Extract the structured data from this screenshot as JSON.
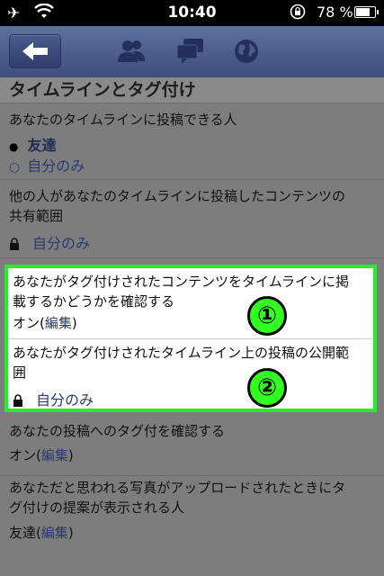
{
  "status_bar": {
    "time": "10:40",
    "battery": "78 %"
  },
  "section": {
    "title": "タイムラインとタグ付け"
  },
  "items": [
    {
      "question": "あなたのタイムラインに投稿できる人",
      "option_selected": "友達",
      "option_other": "自分のみ"
    },
    {
      "question_line1": "他の人があなたのタイムラインに投稿したコンテンツの",
      "question_line2": "共有範囲",
      "value": "自分のみ"
    },
    {
      "question_line1": "あなたがタグ付けされたコンテンツをタイムラインに掲",
      "question_line2": "載するかどうかを確認する",
      "value_prefix": "オン(",
      "edit": "編集",
      "value_suffix": ")"
    },
    {
      "question_line1": "あなたがタグ付けされたタイムライン上の投稿の公開範",
      "question_line2": "囲",
      "value": "自分のみ"
    },
    {
      "question": "あなたの投稿へのタグ付を確認する",
      "value_prefix": "オン(",
      "edit": "編集",
      "value_suffix": ")"
    },
    {
      "question_line1": "あなただと思われる写真がアップロードされたときにタ",
      "question_line2": "グ付けの提案が表示される人",
      "value_prefix": "友達(",
      "edit": "編集",
      "value_suffix": ")"
    }
  ],
  "annotations": {
    "one": "①",
    "two": "②"
  },
  "colors": {
    "navbar": "#3d4d7f",
    "highlight_border": "#22f021",
    "badge": "#30ff20"
  }
}
